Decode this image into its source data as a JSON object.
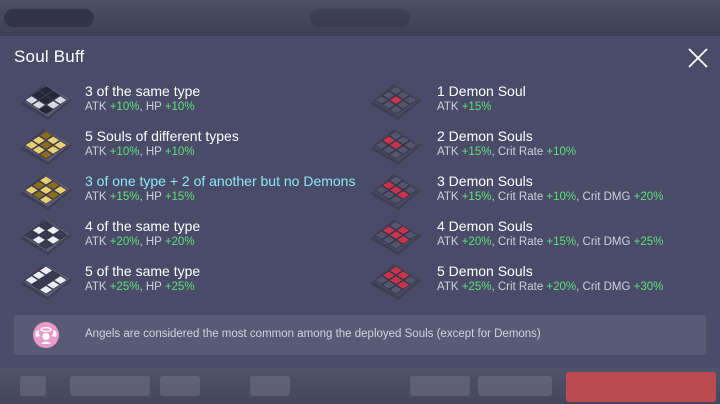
{
  "modal": {
    "title": "Soul Buff",
    "note": "Angels are considered the most common among the deployed Souls (except for Demons)"
  },
  "left_buffs": [
    {
      "title": "3 of the same type",
      "stats": [
        {
          "label": "ATK ",
          "value": "+10%"
        },
        {
          "label": ", HP ",
          "value": "+10%"
        }
      ],
      "icon": "dark-triple-soul-icon"
    },
    {
      "title": "5 Souls of different types",
      "stats": [
        {
          "label": "ATK ",
          "value": "+10%"
        },
        {
          "label": ", HP ",
          "value": "+10%"
        }
      ],
      "icon": "gold-mixed-soul-icon"
    },
    {
      "title": "3 of one type + 2 of another but no Demons",
      "stats": [
        {
          "label": "ATK ",
          "value": "+15%"
        },
        {
          "label": ", HP ",
          "value": "+15%"
        }
      ],
      "icon": "gold-split-soul-icon",
      "highlighted": true
    },
    {
      "title": "4 of the same type",
      "stats": [
        {
          "label": "ATK ",
          "value": "+20%"
        },
        {
          "label": ", HP ",
          "value": "+20%"
        }
      ],
      "icon": "white-quad-soul-icon"
    },
    {
      "title": "5 of the same type",
      "stats": [
        {
          "label": "ATK ",
          "value": "+25%"
        },
        {
          "label": ", HP ",
          "value": "+25%"
        }
      ],
      "icon": "white-quint-soul-icon"
    }
  ],
  "right_buffs": [
    {
      "title": "1 Demon Soul",
      "stats": [
        {
          "label": "ATK ",
          "value": "+15%"
        }
      ],
      "icon": "demon-soul-1-icon"
    },
    {
      "title": "2 Demon Souls",
      "stats": [
        {
          "label": "ATK ",
          "value": "+15%"
        },
        {
          "label": ", Crit Rate ",
          "value": "+10%"
        }
      ],
      "icon": "demon-soul-2-icon"
    },
    {
      "title": "3 Demon Souls",
      "stats": [
        {
          "label": "ATK ",
          "value": "+15%"
        },
        {
          "label": ", Crit Rate ",
          "value": "+10%"
        },
        {
          "label": ", Crit DMG ",
          "value": "+20%"
        }
      ],
      "icon": "demon-soul-3-icon"
    },
    {
      "title": "4 Demon Souls",
      "stats": [
        {
          "label": "ATK ",
          "value": "+20%"
        },
        {
          "label": ", Crit Rate ",
          "value": "+15%"
        },
        {
          "label": ", Crit DMG ",
          "value": "+25%"
        }
      ],
      "icon": "demon-soul-4-icon"
    },
    {
      "title": "5 Demon Souls",
      "stats": [
        {
          "label": "ATK ",
          "value": "+25%"
        },
        {
          "label": ", Crit Rate ",
          "value": "+20%"
        },
        {
          "label": ", Crit DMG ",
          "value": "+30%"
        }
      ],
      "icon": "demon-soul-5-icon"
    }
  ],
  "colors": {
    "value_green": "#5fe07a",
    "highlight_cyan": "#8be9f4",
    "modal_bg": "#4a4b69",
    "demon_red": "#c8344a"
  }
}
